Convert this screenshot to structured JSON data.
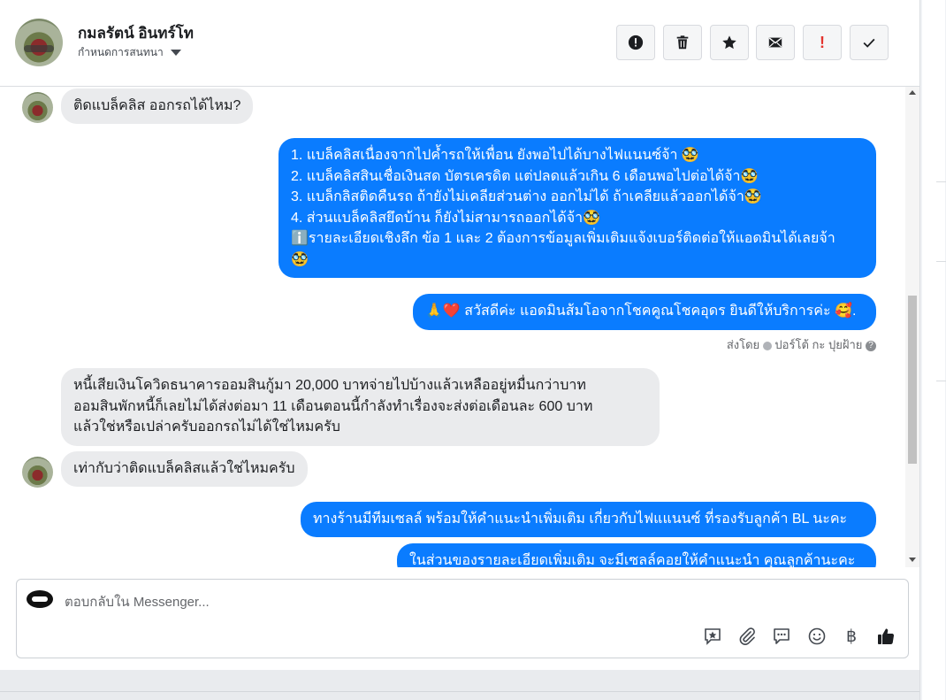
{
  "header": {
    "contact_name": "กมลรัตน์ อินทร์โท",
    "assign_label": "กำหนดการสนทนา",
    "actions": [
      {
        "name": "report-spam-icon"
      },
      {
        "name": "delete-icon"
      },
      {
        "name": "star-icon"
      },
      {
        "name": "mail-icon"
      },
      {
        "name": "mark-important-icon",
        "glyph": "!"
      },
      {
        "name": "mark-done-icon"
      }
    ]
  },
  "messages": {
    "m1": "ติดแบล็คลิส ออกรถได้ไหม?",
    "m2": [
      "1. แบล็คลิสเนื่องจากไปค้ำรถให้เพื่อน ยังพอไปได้บางไฟแนนซ์จ้า 🥸",
      "2. แบล็คลิสสินเชื่อเงินสด บัตรเครดิต แต่ปลดแล้วเกิน 6 เดือนพอไปต่อได้จ้า🥸",
      "3. แบล็กลิสติดคืนรถ ถ้ายังไม่เคลียส่วนต่าง ออกไม่ได้ ถ้าเคลียแล้วออกได้จ้า🥸",
      "4. ส่วนแบล็คลิสยึดบ้าน ก็ยังไม่สามารถออกได้จ้า🥸",
      "ℹ️รายละเอียดเชิงลึก ข้อ 1 และ 2 ต้องการข้อมูลเพิ่มเติมแจ้งเบอร์ติดต่อให้แอดมินได้เลยจ้า",
      "🥸"
    ],
    "m3": "🙏❤️ สวัสดีค่ะ แอดมินส้มโอจากโชคคูณโชคอุดร ยินดีให้บริการค่ะ  🥰.",
    "sent_by": {
      "prefix": "ส่งโดย",
      "name": "ปอร์โต้ กะ ปุยฝ้าย",
      "help": "?"
    },
    "m4": [
      "หนี้เสียเงินโควิดธนาคารออมสินกู้มา 20,000 บาทจ่ายไปบ้างแล้วเหลืออยู่หมื่นกว่าบาท",
      "ออมสินพักหนี้ก็เลยไม่ได้ส่งต่อมา 11 เดือนตอนนี้กำลังทำเรื่องจะส่งต่อเดือนละ 600 บาท",
      "แล้วใช่หรือเปล่าครับออกรถไม่ได้ใช่ไหมครับ"
    ],
    "m5": "เท่ากับว่าติดแบล็คลิสแล้วใช่ไหมครับ",
    "m6": "ทางร้านมีทีมเซลล์ พร้อมให้คำแนะนำเพิ่มเติม เกี่ยวกับไฟแแนนซ์ ที่รองรับลูกค้า BL นะคะ",
    "m7": "ในส่วนของรายละเอียดเพิ่มเติม จะมีเซลล์คอยให้คำแนะนำ คุณลูกค้านะคะ"
  },
  "composer": {
    "placeholder": "ตอบกลับใน Messenger...",
    "tools": [
      "saved-reply-icon",
      "attach-icon",
      "chat-icon",
      "emoji-icon",
      "currency-baht-icon",
      "like-icon"
    ],
    "currency_symbol": "฿"
  },
  "colors": {
    "outgoing": "#0a7cff",
    "incoming": "#eaebed"
  }
}
